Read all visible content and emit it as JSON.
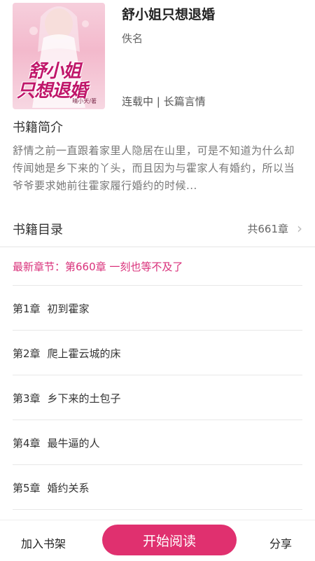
{
  "book": {
    "title": "舒小姐只想退婚",
    "author": "佚名",
    "status": "连载中 | 长篇言情",
    "cover_title_line1": "舒小姐",
    "cover_title_line2": "只想退婚",
    "cover_author": "晴小天/著"
  },
  "intro": {
    "heading": "书籍简介",
    "text": "舒情之前一直跟着家里人隐居在山里，可是不知道为什么却传闻她是乡下来的丫头，而且因为与霍家人有婚约，所以当爷爷要求她前往霍家履行婚约的时候..."
  },
  "toc": {
    "heading": "书籍目录",
    "count": "共661章",
    "latest": "最新章节：第660章 一刻也等不及了",
    "chapters": [
      {
        "num": "第1章",
        "title": "初到霍家"
      },
      {
        "num": "第2章",
        "title": "爬上霍云城的床"
      },
      {
        "num": "第3章",
        "title": "乡下来的土包子"
      },
      {
        "num": "第4章",
        "title": "最牛逼的人"
      },
      {
        "num": "第5章",
        "title": "婚约关系"
      }
    ]
  },
  "bottom": {
    "add_shelf": "加入书架",
    "start_read": "开始阅读",
    "share": "分享"
  },
  "colors": {
    "accent": "#e0306f",
    "latest_text": "#d9307a"
  }
}
